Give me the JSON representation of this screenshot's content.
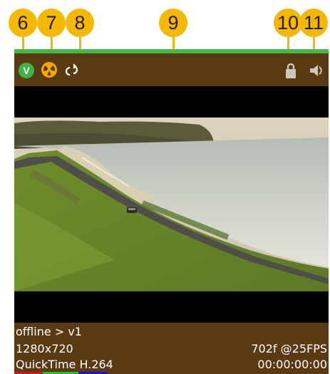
{
  "callouts": [
    "6",
    "7",
    "8",
    "9",
    "10",
    "11"
  ],
  "toolbar": {
    "version_badge": "V",
    "icons": [
      "version-icon",
      "nuke-icon",
      "loop-icon",
      "lock-icon",
      "speaker-icon"
    ]
  },
  "info": {
    "source": "offline > v1",
    "resolution": "1280x720",
    "codec": "QuickTime H.264",
    "frames": "702f @25FPS",
    "timecode": "00:00:00:00"
  },
  "colors": {
    "panel": "#5a3a12",
    "status_bar": "#45b84a",
    "callout": "#f5b800",
    "version_badge": "#3bb44a",
    "nuke_icon": "#f5a800"
  }
}
